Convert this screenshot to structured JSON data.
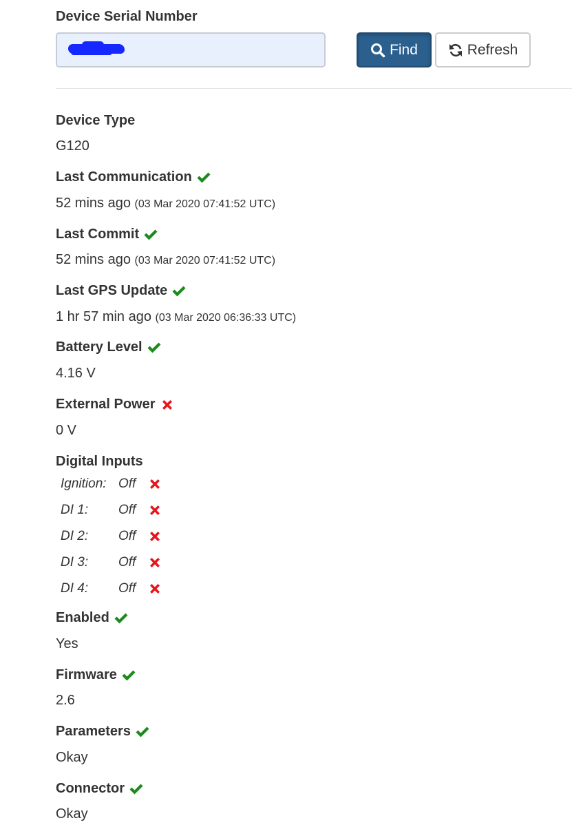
{
  "serial": {
    "label": "Device Serial Number",
    "value": ""
  },
  "buttons": {
    "find_label": "Find",
    "refresh_label": "Refresh"
  },
  "colors": {
    "ok": "#1c8a1c",
    "fail": "#e8141c",
    "primary": "#2b5f8e"
  },
  "fields": {
    "device_type": {
      "label": "Device Type",
      "value": "G120"
    },
    "last_communication": {
      "label": "Last Communication",
      "status": "ok",
      "value": "52 mins ago",
      "detail": "(03 Mar 2020 07:41:52 UTC)"
    },
    "last_commit": {
      "label": "Last Commit",
      "status": "ok",
      "value": "52 mins ago",
      "detail": "(03 Mar 2020 07:41:52 UTC)"
    },
    "last_gps_update": {
      "label": "Last GPS Update",
      "status": "ok",
      "value": "1 hr 57 min ago",
      "detail": "(03 Mar 2020 06:36:33 UTC)"
    },
    "battery_level": {
      "label": "Battery Level",
      "status": "ok",
      "value": "4.16 V"
    },
    "external_power": {
      "label": "External Power",
      "status": "fail",
      "value": "0 V"
    },
    "enabled": {
      "label": "Enabled",
      "status": "ok",
      "value": "Yes"
    },
    "firmware": {
      "label": "Firmware",
      "status": "ok",
      "value": "2.6"
    },
    "parameters": {
      "label": "Parameters",
      "status": "ok",
      "value": "Okay"
    },
    "connector": {
      "label": "Connector",
      "status": "ok",
      "value": "Okay"
    }
  },
  "digital_inputs": {
    "label": "Digital Inputs",
    "items": [
      {
        "name": "Ignition:",
        "state": "Off",
        "status": "fail"
      },
      {
        "name": "DI 1:",
        "state": "Off",
        "status": "fail"
      },
      {
        "name": "DI 2:",
        "state": "Off",
        "status": "fail"
      },
      {
        "name": "DI 3:",
        "state": "Off",
        "status": "fail"
      },
      {
        "name": "DI 4:",
        "state": "Off",
        "status": "fail"
      }
    ]
  }
}
